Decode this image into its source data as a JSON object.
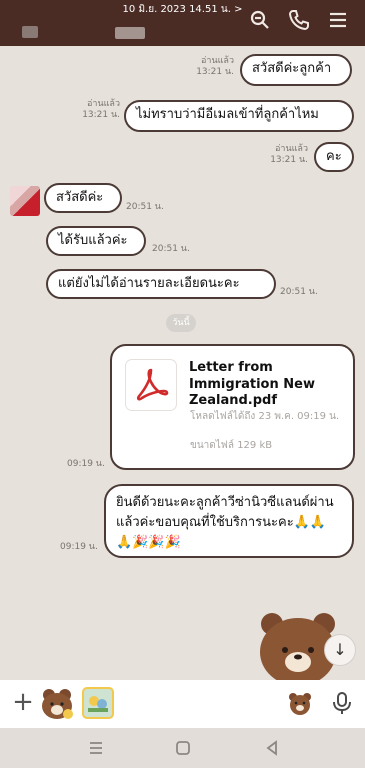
{
  "status": {
    "date_time": "10 มิ.ย. 2023 14.51 น. >"
  },
  "header": {
    "icons": [
      "search-icon",
      "phone-icon",
      "menu-icon"
    ]
  },
  "messages": {
    "out1": {
      "text": "สวัสดีค่ะลูกค้า",
      "read": "อ่านแล้ว",
      "time": "13:21 น."
    },
    "out2": {
      "text": "ไม่ทราบว่ามีอีเมลเข้าที่ลูกค้าไหม",
      "read": "อ่านแล้ว",
      "time": "13:21 น."
    },
    "out3": {
      "text": "คะ",
      "read": "อ่านแล้ว",
      "time": "13:21 น."
    },
    "in1": {
      "text": "สวัสดีค่ะ",
      "time": "20:51 น."
    },
    "in2": {
      "text": "ได้รับแล้วค่ะ",
      "time": "20:51 น."
    },
    "in3": {
      "text": "แต่ยังไม่ได้อ่านรายละเอียดนะคะ",
      "time": "20:51 น."
    }
  },
  "day_divider": "วันนี้",
  "file_message": {
    "filename": "Letter from Immigration New Zealand.pdf",
    "expires": "โหลดไฟล์ได้ถึง 23 พ.ค. 09:19 น.",
    "size": "ขนาดไฟล์ 129 kB",
    "time": "09:19 น."
  },
  "congrats_message": {
    "text": "ยินดีด้วยนะคะลูกค้าวีซ่านิวซีแลนด์ผ่านแล้วค่ะขอบคุณที่ใช้บริการนะคะ🙏🙏🙏🎉🎉🎉",
    "time": "09:19 น."
  },
  "colors": {
    "header": "#4a2c25",
    "background": "#e6e1db",
    "bubble_border": "#4b3a35",
    "pdf_red": "#d12b2b"
  }
}
